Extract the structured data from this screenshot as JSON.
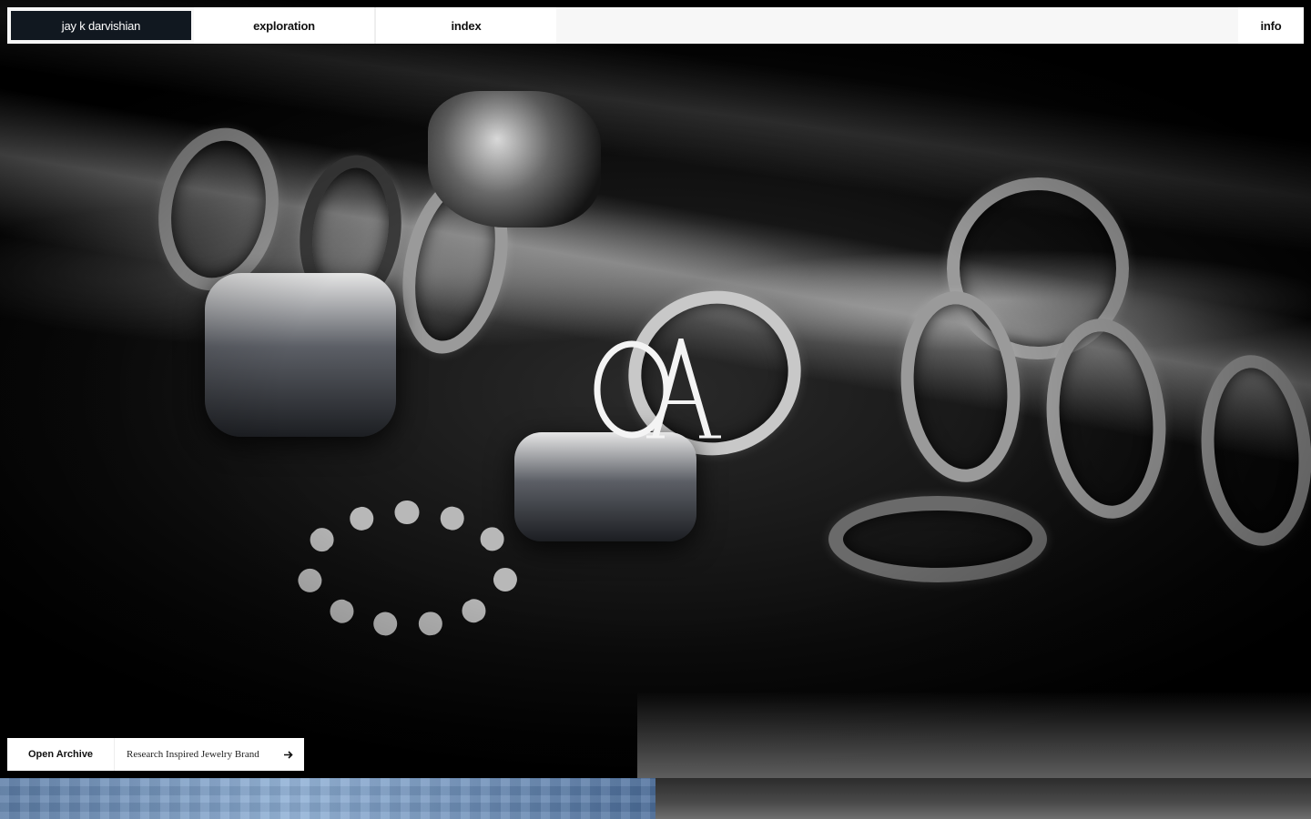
{
  "nav": {
    "brand": "jay k darvishian",
    "exploration": "exploration",
    "index": "index",
    "info": "info"
  },
  "hero": {
    "monogram": "OA",
    "image_subject": "silver-rings-on-binder"
  },
  "archive_card": {
    "button_label": "Open Archive",
    "description": "Research Inspired Jewelry Brand",
    "arrow_icon": "arrow-right-icon"
  },
  "colors": {
    "brand_bg": "#111820",
    "nav_bg": "#f7f7f7",
    "strip_blue": "#8fb0d6"
  }
}
